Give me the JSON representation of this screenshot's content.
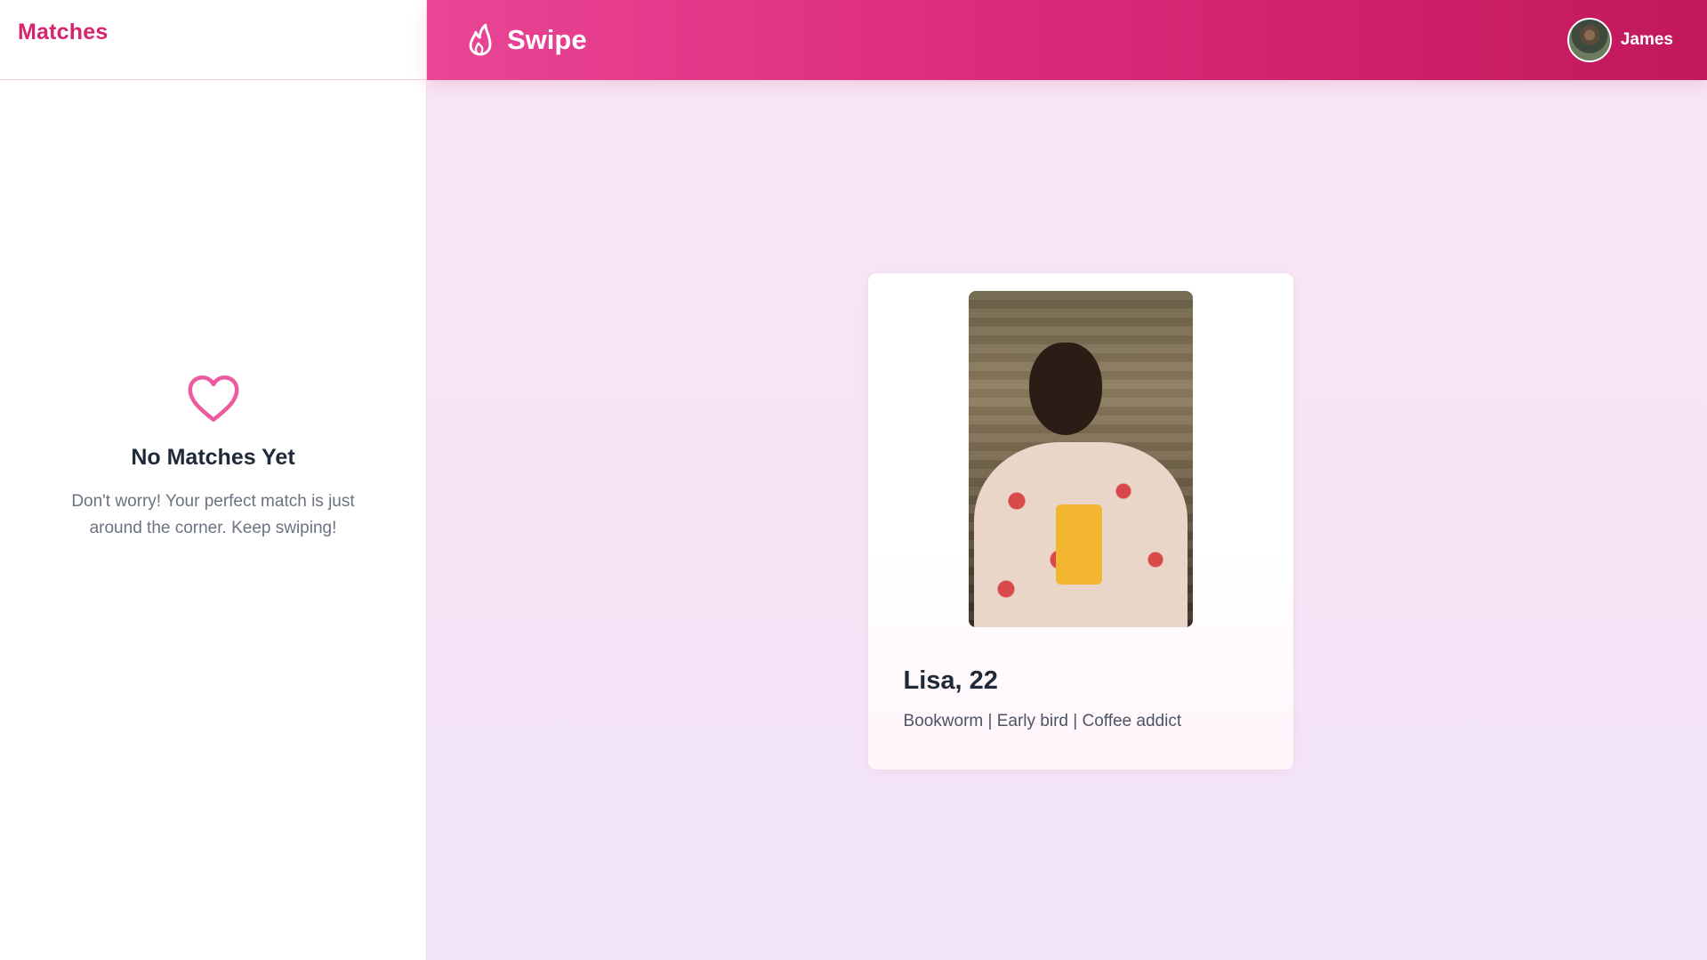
{
  "sidebar": {
    "title": "Matches",
    "empty_state": {
      "icon": "heart-outline-icon",
      "title": "No Matches Yet",
      "text": "Don't worry! Your perfect match is just around the corner. Keep swiping!"
    }
  },
  "header": {
    "brand_icon": "flame-icon",
    "brand_name": "Swipe",
    "user": {
      "name": "James",
      "avatar": "avatar-icon"
    }
  },
  "profile_card": {
    "name_age": "Lisa, 22",
    "bio": "Bookworm | Early bird | Coffee addict"
  },
  "colors": {
    "accent": "#d6246e",
    "header_gradient_start": "#ea4595",
    "header_gradient_end": "#c2185b",
    "heart": "#ec5a9f",
    "main_background": "#f7e6f5"
  }
}
